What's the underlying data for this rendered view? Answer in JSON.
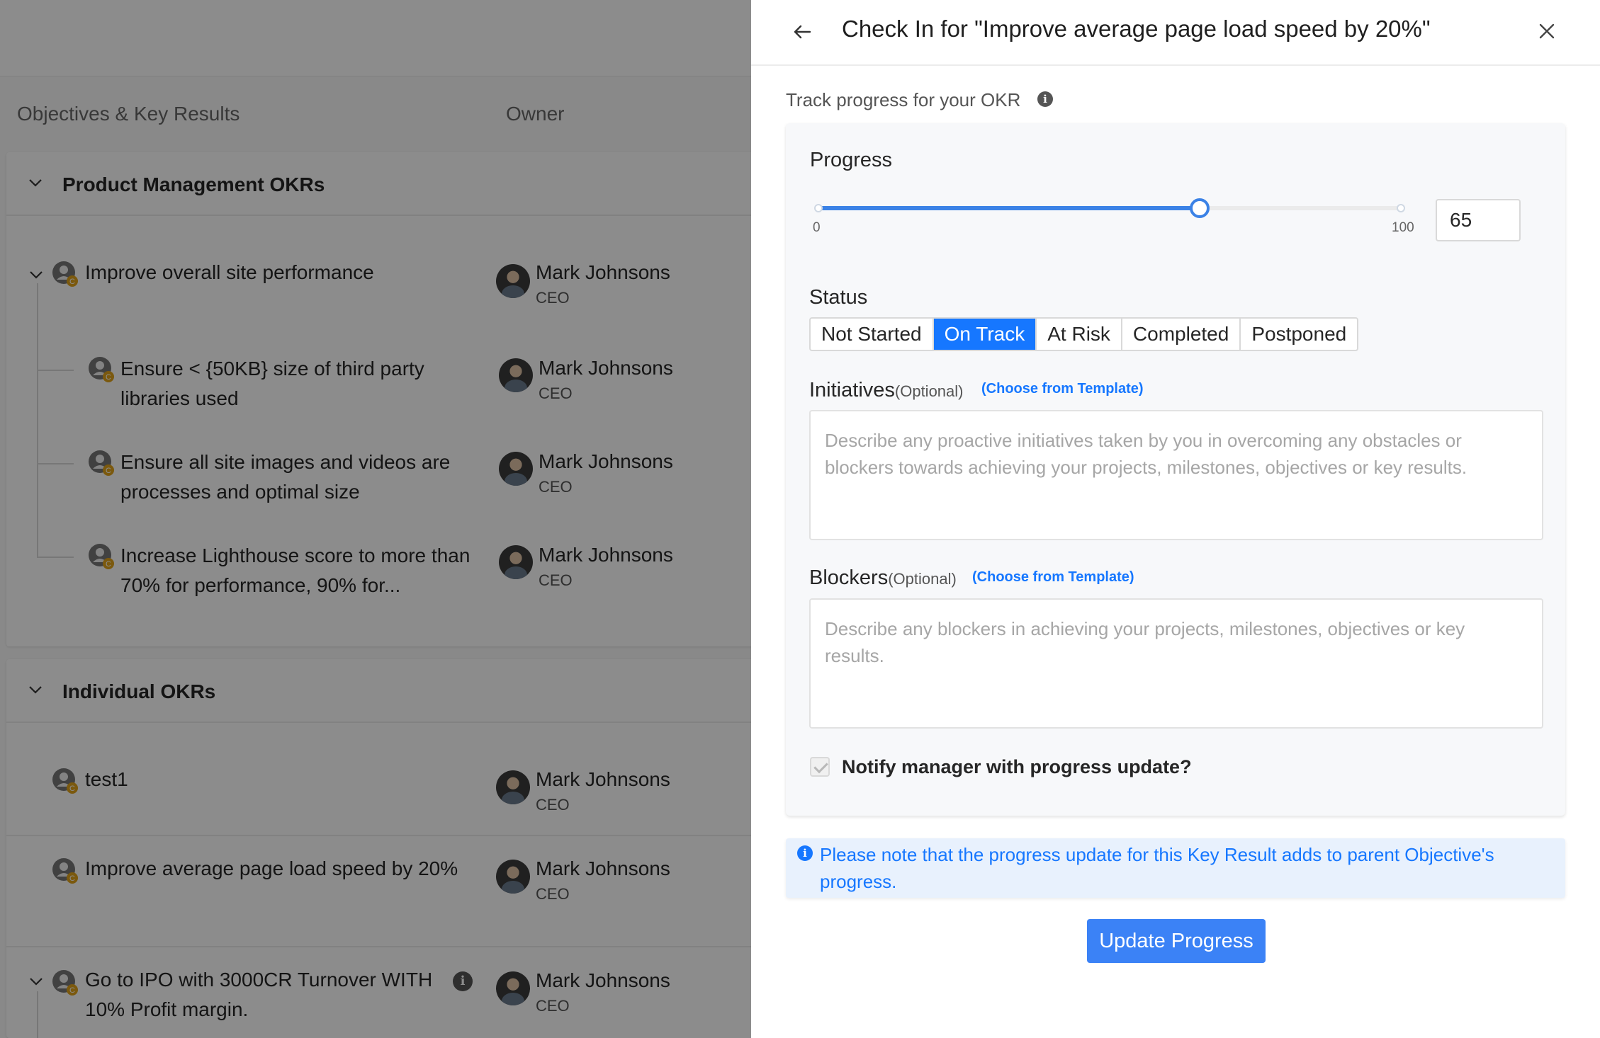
{
  "background": {
    "columns": {
      "objectives": "Objectives & Key Results",
      "owner": "Owner"
    },
    "sections": [
      {
        "title": "Product Management OKRs",
        "rows": [
          {
            "title": "Improve overall site performance",
            "owner": "Mark Johnsons",
            "role": "CEO"
          },
          {
            "title": "Ensure < {50KB} size of third party libraries used",
            "owner": "Mark Johnsons",
            "role": "CEO"
          },
          {
            "title": "Ensure all site images and videos are processes and optimal size",
            "owner": "Mark Johnsons",
            "role": "CEO"
          },
          {
            "title": "Increase Lighthouse score to more than 70% for performance, 90% for...",
            "owner": "Mark Johnsons",
            "role": "CEO"
          }
        ]
      },
      {
        "title": "Individual OKRs",
        "rows": [
          {
            "title": "test1",
            "owner": "Mark Johnsons",
            "role": "CEO"
          },
          {
            "title": "Improve average page load speed by 20%",
            "owner": "Mark Johnsons",
            "role": "CEO"
          },
          {
            "title": "Go to IPO with 3000CR Turnover WITH 10% Profit margin.",
            "owner": "Mark Johnsons",
            "role": "CEO"
          }
        ]
      }
    ],
    "okr_icon_badge": "C"
  },
  "drawer": {
    "title": "Check In for \"Improve average page load speed by 20%\"",
    "track_label": "Track progress for your OKR",
    "progress": {
      "label": "Progress",
      "value": 65,
      "input_value": "65",
      "min_label": "0",
      "max_label": "100"
    },
    "status": {
      "label": "Status",
      "options": [
        "Not Started",
        "On Track",
        "At Risk",
        "Completed",
        "Postponed"
      ],
      "selected": "On Track"
    },
    "initiatives": {
      "label": "Initiatives",
      "optional": "(Optional)",
      "template_link": "(Choose from Template)",
      "placeholder": "Describe any proactive initiatives taken by you in overcoming any obstacles or blockers towards achieving your projects, milestones, objectives or key results."
    },
    "blockers": {
      "label": "Blockers",
      "optional": "(Optional)",
      "template_link": "(Choose from Template)",
      "placeholder": "Describe any blockers in achieving your projects, milestones, objectives or key results."
    },
    "notify_label": "Notify manager with progress update?",
    "notify_checked": true,
    "note": "Please note that the progress update for this Key Result adds to parent Objective's progress.",
    "submit_label": "Update Progress"
  },
  "colors": {
    "accent": "#1677ff",
    "button": "#3b82f6",
    "note_bg": "#e8f1fd"
  }
}
